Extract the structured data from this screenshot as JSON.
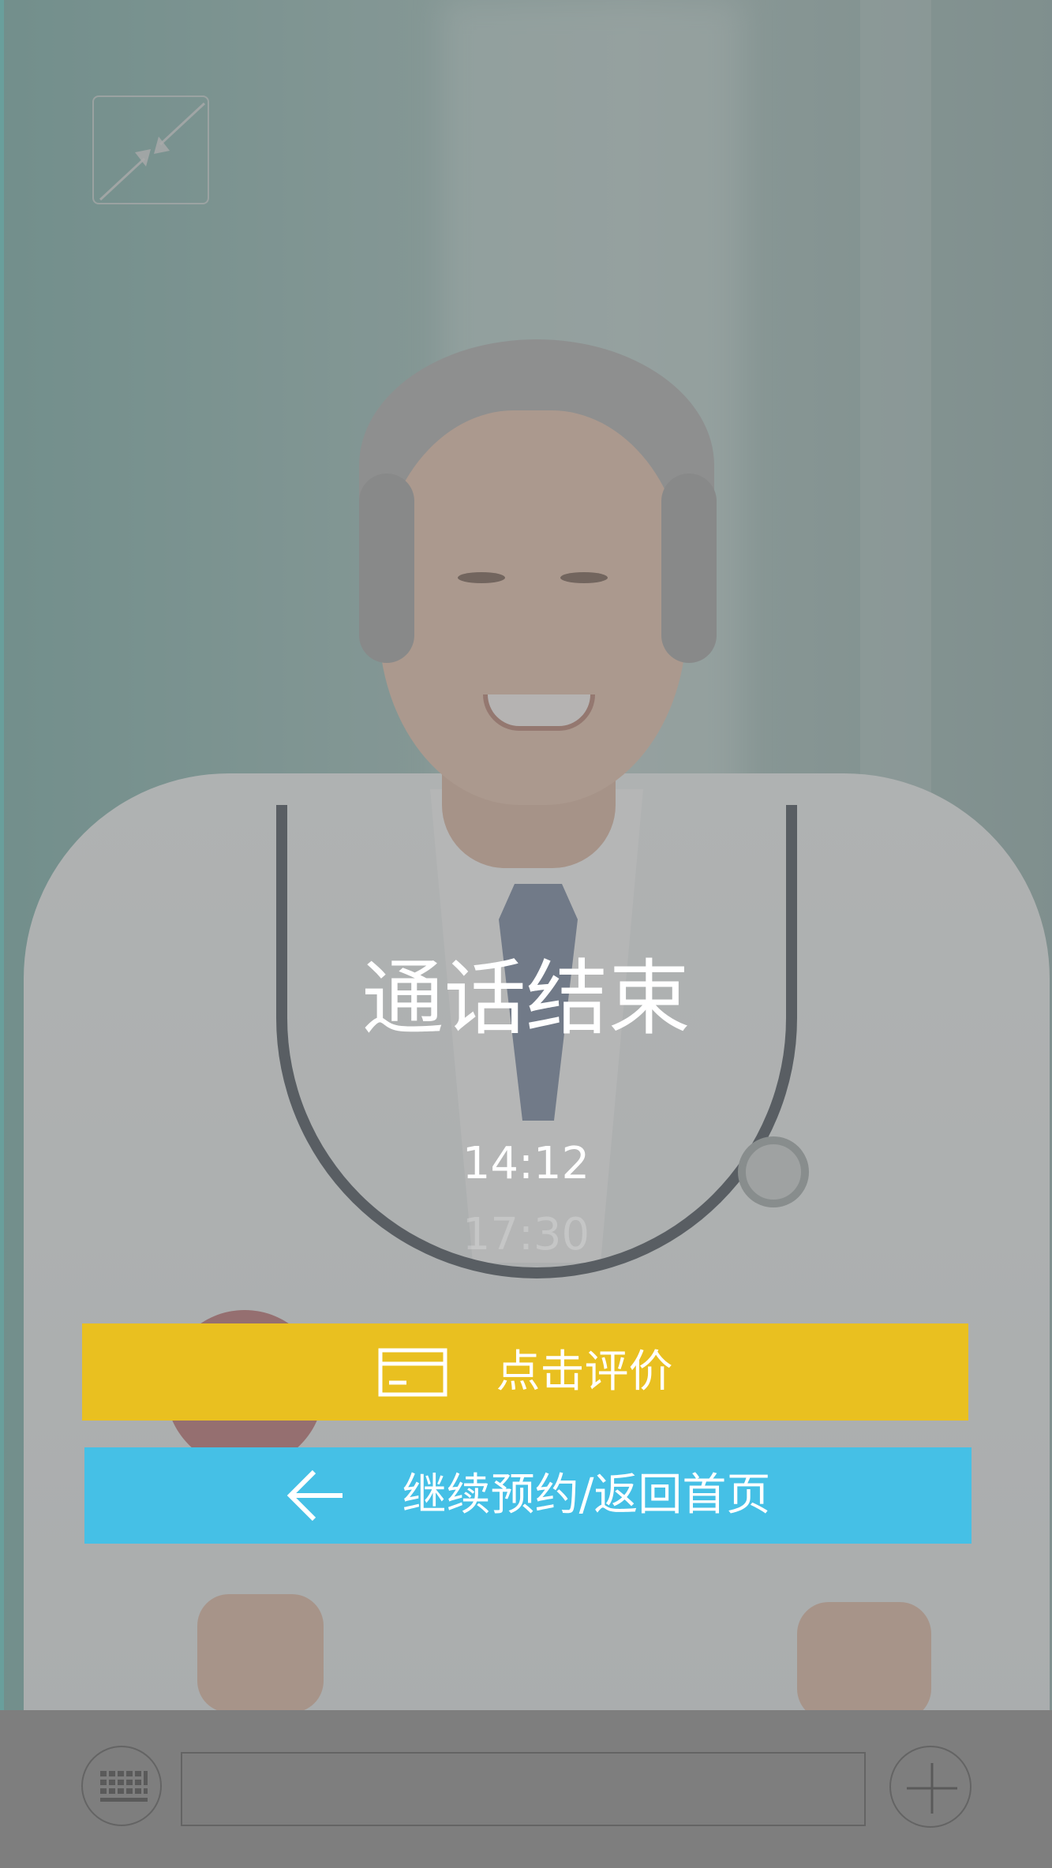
{
  "call": {
    "status_title": "通话结束",
    "duration": "14:12",
    "secondary_time": "17:30"
  },
  "actions": {
    "rate_label": "点击评价",
    "rate_color": "#e9c020",
    "back_label": "继续预约/返回首页",
    "back_color": "#45c0e6"
  },
  "icons": {
    "minimize": "shrink-arrows-icon",
    "rate": "card-icon",
    "back": "arrow-left-icon",
    "keyboard": "keyboard-icon",
    "plus": "plus-icon"
  },
  "composer": {
    "input_value": "",
    "input_placeholder": ""
  }
}
